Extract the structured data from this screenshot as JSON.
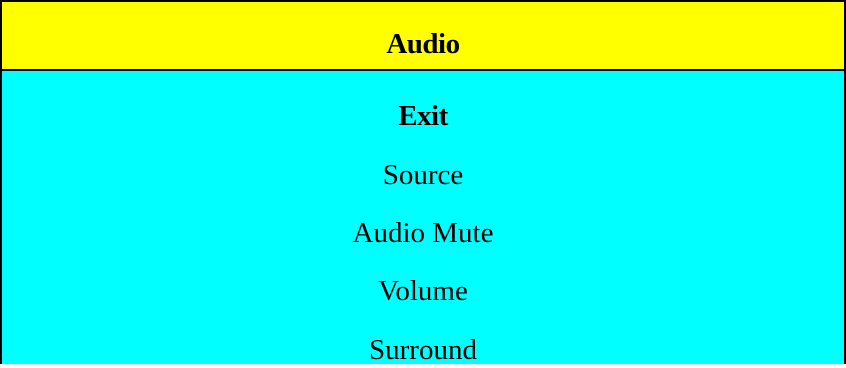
{
  "menu": {
    "title": "Audio",
    "items": [
      {
        "label": "Exit",
        "selected": true
      },
      {
        "label": "Source",
        "selected": false
      },
      {
        "label": "Audio Mute",
        "selected": false
      },
      {
        "label": "Volume",
        "selected": false
      },
      {
        "label": "Surround",
        "selected": false
      }
    ]
  },
  "colors": {
    "header_background": "#ffff00",
    "body_background": "#00ffff",
    "border": "#000000",
    "text": "#000000"
  }
}
